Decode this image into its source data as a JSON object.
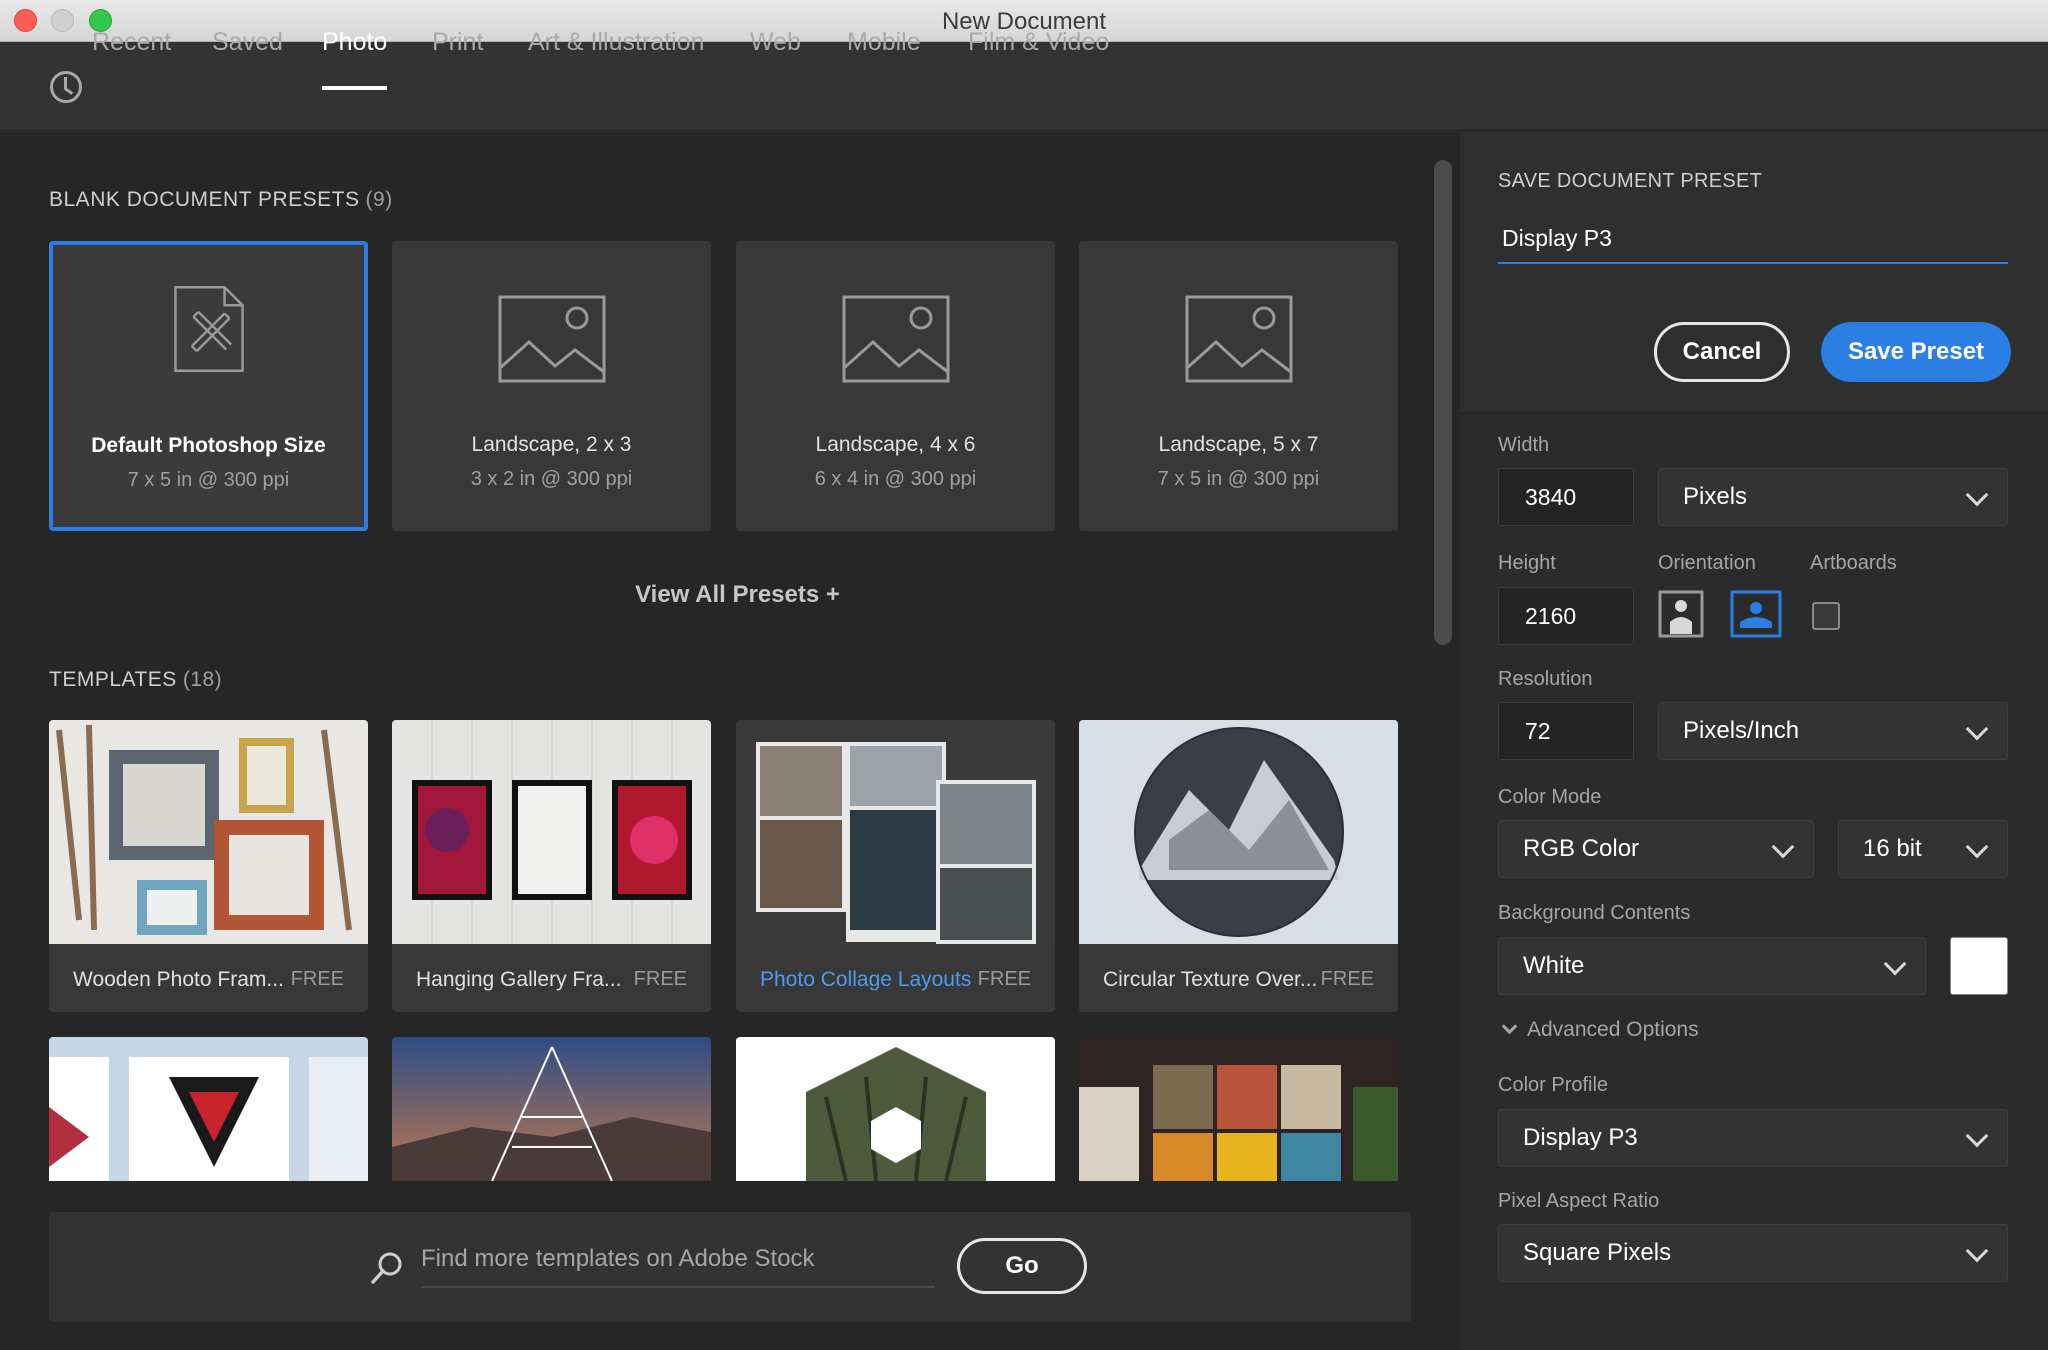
{
  "window": {
    "title": "New Document"
  },
  "tabs": [
    {
      "label": "Recent"
    },
    {
      "label": "Saved"
    },
    {
      "label": "Photo"
    },
    {
      "label": "Print"
    },
    {
      "label": "Art & Illustration"
    },
    {
      "label": "Web"
    },
    {
      "label": "Mobile"
    },
    {
      "label": "Film & Video"
    }
  ],
  "active_tab": "Photo",
  "presets": {
    "title": "BLANK DOCUMENT PRESETS",
    "count": "(9)",
    "items": [
      {
        "name": "Default Photoshop Size",
        "sub": "7 x 5 in @ 300 ppi",
        "icon": "document-ruler-icon",
        "selected": true
      },
      {
        "name": "Landscape, 2 x 3",
        "sub": "3 x 2 in @ 300 ppi",
        "icon": "image-icon"
      },
      {
        "name": "Landscape, 4 x 6",
        "sub": "6 x 4 in @ 300 ppi",
        "icon": "image-icon"
      },
      {
        "name": "Landscape, 5 x 7",
        "sub": "7 x 5 in @ 300 ppi",
        "icon": "image-icon"
      }
    ],
    "view_all": "View All Presets +"
  },
  "templates": {
    "title": "TEMPLATES",
    "count": "(18)",
    "items": [
      {
        "name": "Wooden Photo Fram...",
        "badge": "FREE"
      },
      {
        "name": "Hanging Gallery Fra...",
        "badge": "FREE"
      },
      {
        "name": "Photo Collage Layouts",
        "badge": "FREE",
        "link": true
      },
      {
        "name": "Circular Texture Over...",
        "badge": "FREE"
      }
    ]
  },
  "stock_search": {
    "placeholder": "Find more templates on Adobe Stock",
    "go_label": "Go"
  },
  "save_preset": {
    "title": "SAVE DOCUMENT PRESET",
    "name_value": "Display P3",
    "cancel_label": "Cancel",
    "save_label": "Save Preset"
  },
  "details": {
    "width_label": "Width",
    "width_value": "3840",
    "width_unit": "Pixels",
    "height_label": "Height",
    "height_value": "2160",
    "orientation_label": "Orientation",
    "orientation_selected": "landscape",
    "artboards_label": "Artboards",
    "artboards_checked": false,
    "resolution_label": "Resolution",
    "resolution_value": "72",
    "resolution_unit": "Pixels/Inch",
    "color_mode_label": "Color Mode",
    "color_mode_value": "RGB Color",
    "bit_depth_value": "16 bit",
    "background_label": "Background Contents",
    "background_value": "White",
    "background_swatch": "#ffffff",
    "advanced_label": "Advanced Options",
    "color_profile_label": "Color Profile",
    "color_profile_value": "Display P3",
    "pixel_aspect_label": "Pixel Aspect Ratio",
    "pixel_aspect_value": "Square Pixels"
  },
  "colors": {
    "accent": "#2b7fe4",
    "link": "#4e9cf0",
    "panel_bg": "#262626",
    "sidebar_bg": "#2b2b2b"
  }
}
